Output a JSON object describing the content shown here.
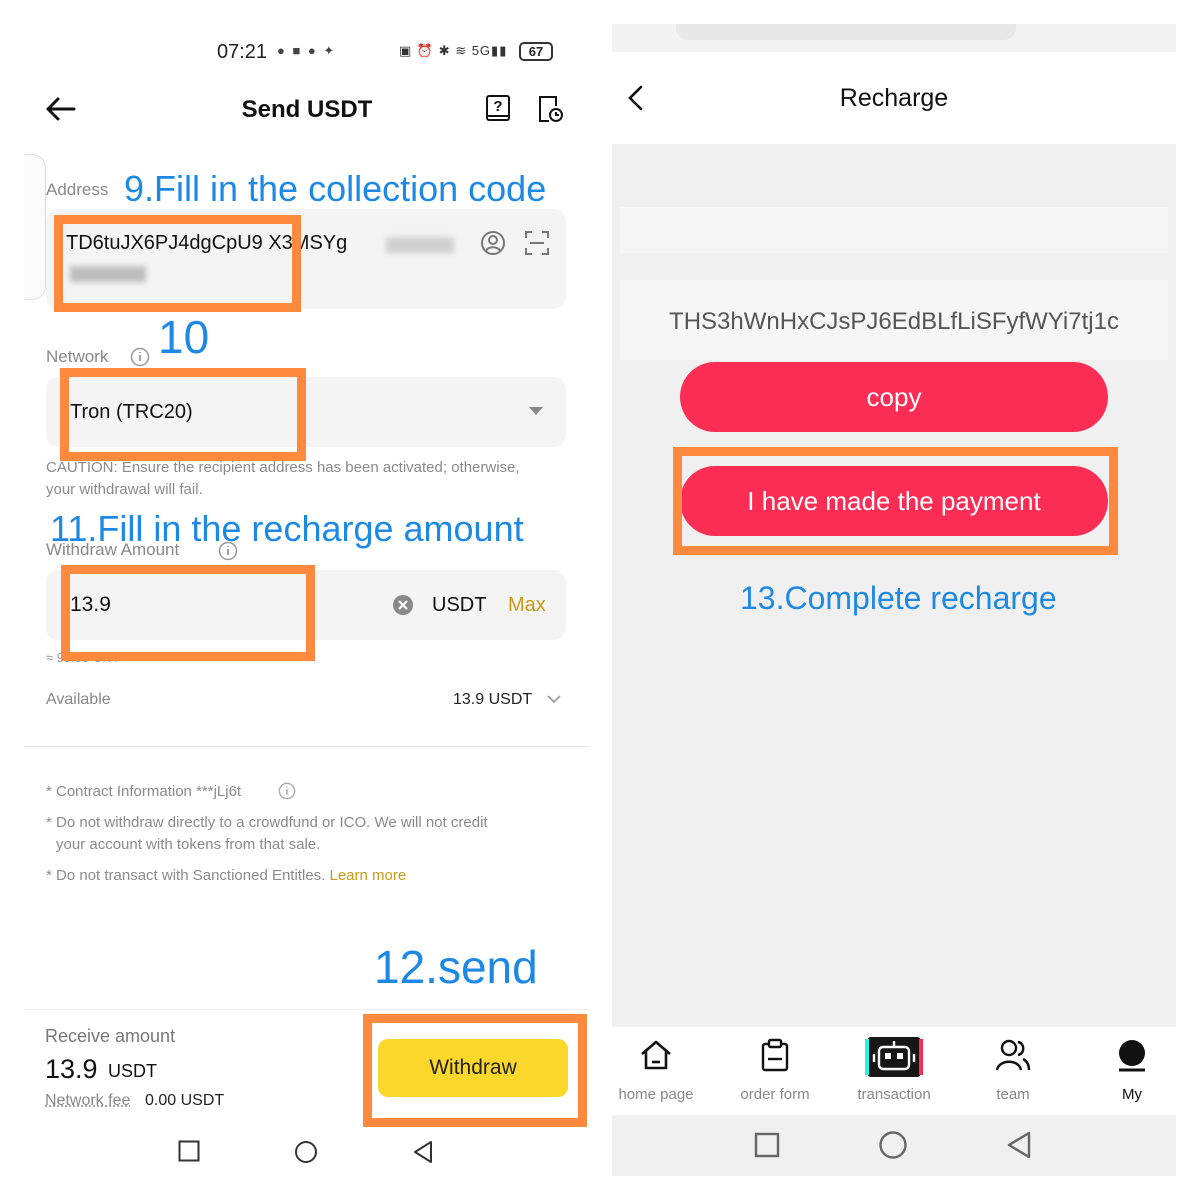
{
  "left_screen": {
    "status_bar": {
      "time": "07:21",
      "signal": "5G",
      "battery": "67"
    },
    "title": "Send USDT",
    "address": {
      "label": "Address",
      "value_line1": "TD6tuJX6PJ4dgCpU9 X3MSYg",
      "value_line2": ""
    },
    "network": {
      "label": "Network",
      "value": "Tron (TRC20)"
    },
    "caution": "CAUTION: Ensure the recipient address has been activated; otherwise, your withdrawal will fail.",
    "withdraw_amount": {
      "label": "Withdraw Amount",
      "value": "13.9",
      "currency": "USDT",
      "max_label": "Max",
      "approx": "≈ 99.80 CNY"
    },
    "available": {
      "label": "Available",
      "value": "13.9 USDT"
    },
    "notes": {
      "contract": "* Contract Information ***jLj6t",
      "crowdfund_line1": "* Do not withdraw directly to a crowdfund or ICO. We will not credit",
      "crowdfund_line2": "your account with tokens from that sale.",
      "sanctioned": "* Do not transact with Sanctioned Entitles.",
      "learn_more": "Learn more"
    },
    "receive": {
      "label": "Receive amount",
      "amount": "13.9",
      "currency": "USDT",
      "fee_label": "Network fee",
      "fee_value": "0.00 USDT"
    },
    "withdraw_button": "Withdraw"
  },
  "annotations": {
    "step9": "9.Fill in the collection code",
    "step10": "10",
    "step11": "11.Fill in the recharge amount",
    "step12": "12.send",
    "step13": "13.Complete recharge"
  },
  "right_screen": {
    "title": "Recharge",
    "address": "THS3hWnHxCJsPJ6EdBLfLiSFyfWYi7tj1c",
    "copy_button": "copy",
    "paid_button": "I have made the payment",
    "tabs": [
      {
        "label": "home page",
        "icon": "home-icon"
      },
      {
        "label": "order form",
        "icon": "clipboard-icon"
      },
      {
        "label": "transaction",
        "icon": "robot-icon"
      },
      {
        "label": "team",
        "icon": "team-icon"
      },
      {
        "label": "My",
        "icon": "profile-icon"
      }
    ]
  },
  "colors": {
    "annotation_blue": "#1e88e5",
    "highlight_orange": "#ff8a3d",
    "withdraw_yellow": "#fbd72b",
    "recharge_red": "#fc2d55",
    "gold_link": "#c99a14"
  }
}
